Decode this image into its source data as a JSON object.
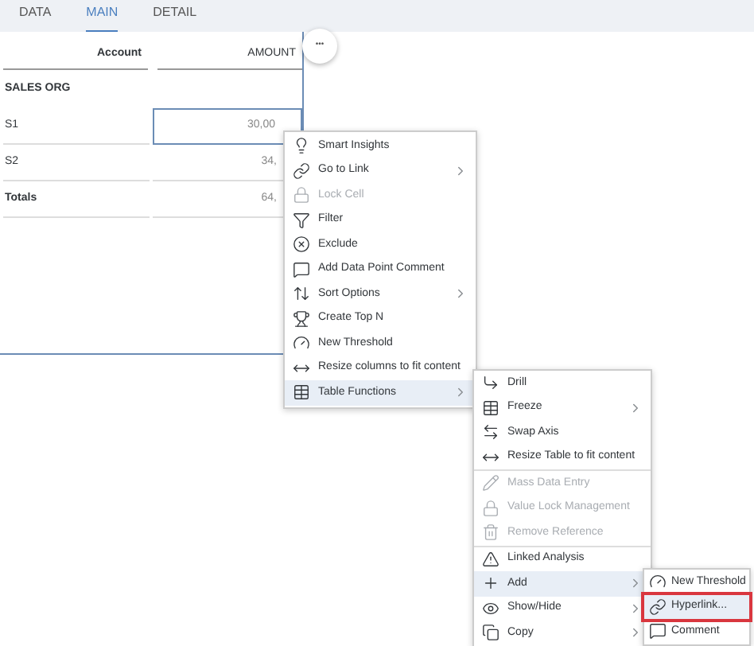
{
  "tabs": [
    {
      "label": "DATA",
      "selected": false
    },
    {
      "label": "MAIN",
      "selected": true
    },
    {
      "label": "DETAIL",
      "selected": false
    }
  ],
  "table": {
    "columns": [
      "Account",
      "AMOUNT"
    ],
    "section": "SALES ORG",
    "rows": [
      {
        "label": "S1",
        "value": "30,00",
        "selected": true,
        "bold": false
      },
      {
        "label": "S2",
        "value": "34,",
        "selected": false,
        "bold": false
      },
      {
        "label": "Totals",
        "value": "64,",
        "selected": false,
        "bold": true
      }
    ]
  },
  "more_button": "•••",
  "context_menu": [
    {
      "label": "Smart Insights",
      "disabled": false,
      "submenu": false,
      "selected": false
    },
    {
      "label": "Go to Link",
      "disabled": false,
      "submenu": true,
      "selected": false
    },
    {
      "label": "Lock Cell",
      "disabled": true,
      "submenu": false,
      "selected": false
    },
    {
      "label": "Filter",
      "disabled": false,
      "submenu": false,
      "selected": false
    },
    {
      "label": "Exclude",
      "disabled": false,
      "submenu": false,
      "selected": false
    },
    {
      "label": "Add Data Point Comment",
      "disabled": false,
      "submenu": false,
      "selected": false
    },
    {
      "label": "Sort Options",
      "disabled": false,
      "submenu": true,
      "selected": false
    },
    {
      "label": "Create Top N",
      "disabled": false,
      "submenu": false,
      "selected": false
    },
    {
      "label": "New Threshold",
      "disabled": false,
      "submenu": false,
      "selected": false
    },
    {
      "label": "Resize columns to fit content",
      "disabled": false,
      "submenu": false,
      "selected": false
    },
    {
      "label": "Table Functions",
      "disabled": false,
      "submenu": true,
      "selected": true
    }
  ],
  "table_functions_menu": [
    {
      "label": "Drill",
      "disabled": false,
      "submenu": false,
      "selected": false,
      "divider_before": false
    },
    {
      "label": "Freeze",
      "disabled": false,
      "submenu": true,
      "selected": false,
      "divider_before": false
    },
    {
      "label": "Swap Axis",
      "disabled": false,
      "submenu": false,
      "selected": false,
      "divider_before": false
    },
    {
      "label": "Resize Table to fit content",
      "disabled": false,
      "submenu": false,
      "selected": false,
      "divider_before": false
    },
    {
      "label": "Mass Data Entry",
      "disabled": true,
      "submenu": false,
      "selected": false,
      "divider_before": true
    },
    {
      "label": "Value Lock Management",
      "disabled": true,
      "submenu": false,
      "selected": false,
      "divider_before": false
    },
    {
      "label": "Remove Reference",
      "disabled": true,
      "submenu": false,
      "selected": false,
      "divider_before": false
    },
    {
      "label": "Linked Analysis",
      "disabled": false,
      "submenu": false,
      "selected": false,
      "divider_before": true
    },
    {
      "label": "Add",
      "disabled": false,
      "submenu": true,
      "selected": true,
      "divider_before": false
    },
    {
      "label": "Show/Hide",
      "disabled": false,
      "submenu": true,
      "selected": false,
      "divider_before": false
    },
    {
      "label": "Copy",
      "disabled": false,
      "submenu": true,
      "selected": false,
      "divider_before": false
    }
  ],
  "add_menu": [
    {
      "label": "New Threshold",
      "selected": false,
      "outlined": false
    },
    {
      "label": "Hyperlink...",
      "selected": true,
      "outlined": true
    },
    {
      "label": "Comment",
      "selected": false,
      "outlined": false
    }
  ]
}
